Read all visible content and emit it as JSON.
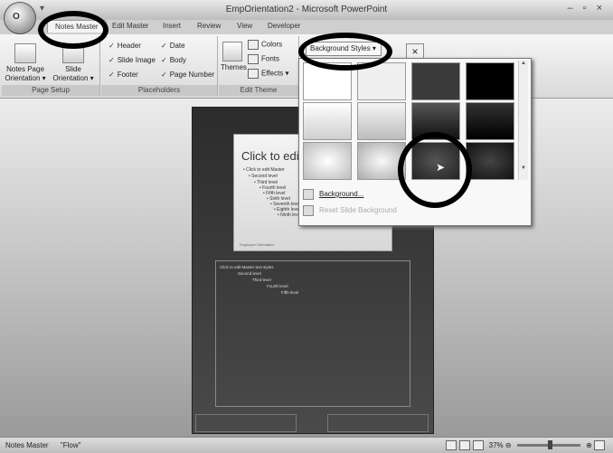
{
  "window": {
    "title": "EmpOrientation2 - Microsoft PowerPoint",
    "controls": "– ▫ ×"
  },
  "office_button": "O",
  "qat": "▾",
  "tabs": [
    {
      "label": "Notes Master",
      "active": true
    },
    {
      "label": "Edit Master"
    },
    {
      "label": "Insert"
    },
    {
      "label": "Review"
    },
    {
      "label": "View"
    },
    {
      "label": "Developer"
    }
  ],
  "ribbon": {
    "page_setup": {
      "notes_page_orientation": "Notes Page Orientation ▾",
      "slide_orientation": "Slide Orientation ▾",
      "label": "Page Setup"
    },
    "placeholders": {
      "header": "Header",
      "date": "Date",
      "slide_image": "Slide Image",
      "body": "Body",
      "footer": "Footer",
      "page_number": "Page Number",
      "label": "Placeholders",
      "check": "✓"
    },
    "edit_theme": {
      "themes": "Themes",
      "colors": "Colors",
      "fonts": "Fonts",
      "effects": "Effects ▾",
      "label": "Edit Theme"
    }
  },
  "background_styles": {
    "button_label": "Background Styles ▾",
    "close": "×",
    "background_item": "Background...",
    "reset_item": "Reset Slide Background",
    "scroll_up": "▲",
    "scroll_down": "▼"
  },
  "slide": {
    "title": "Click to edit",
    "lines": [
      "• Click to edit Master",
      "• Second level",
      "• Third level",
      "• Fourth level",
      "• Fifth level",
      "• Sixth level",
      "• Seventh level",
      "• Eighth level",
      "• Ninth level"
    ],
    "footer": "Employee Orientation"
  },
  "notes": {
    "lines": [
      "Click to edit Master text styles",
      "Second level",
      "Third level",
      "Fourth level",
      "Fifth level"
    ]
  },
  "status": {
    "view": "Notes Master",
    "theme": "\"Flow\"",
    "zoom": "37%",
    "zoom_out": "⊖",
    "zoom_in": "⊕"
  },
  "swatch_colors": [
    "#ffffff",
    "#efefef",
    "#3a3a3a",
    "#000000"
  ]
}
